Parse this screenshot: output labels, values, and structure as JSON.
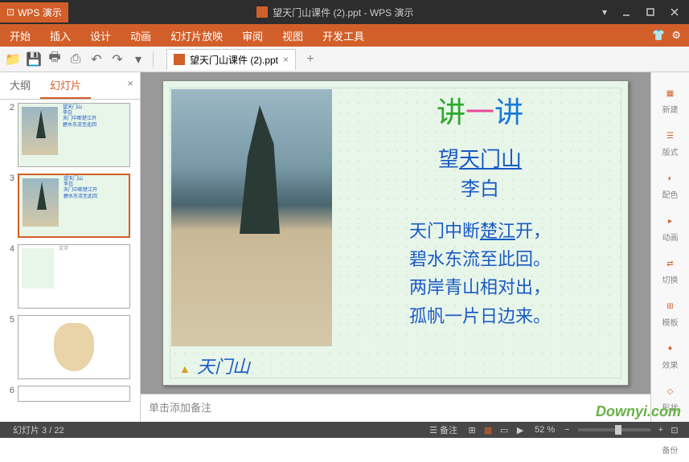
{
  "titlebar": {
    "app_name": "WPS 演示",
    "doc_title": "望天门山课件 (2).ppt - WPS 演示"
  },
  "menubar": {
    "items": [
      "开始",
      "插入",
      "设计",
      "动画",
      "幻灯片放映",
      "审阅",
      "视图",
      "开发工具"
    ]
  },
  "doc_tab": {
    "label": "望天门山课件 (2).ppt"
  },
  "left_panel": {
    "tabs": {
      "outline": "大纲",
      "slides": "幻灯片"
    },
    "thumbs": [
      {
        "num": "2"
      },
      {
        "num": "3"
      },
      {
        "num": "4"
      },
      {
        "num": "5"
      },
      {
        "num": "6"
      }
    ],
    "active_index": 1
  },
  "slide": {
    "title_chars": {
      "c1": "讲",
      "c2": "一",
      "c3": "讲"
    },
    "poem_title_prefix": "望",
    "poem_title_link": "天门山",
    "author": "李白",
    "lines": [
      {
        "text_before": "天门中断",
        "link": "楚江",
        "text_after": "开，"
      },
      {
        "text_before": "碧水东流至此回。",
        "link": "",
        "text_after": ""
      },
      {
        "text_before": "两岸青山相对出，",
        "link": "",
        "text_after": ""
      },
      {
        "text_before": "孤帆一片日边来。",
        "link": "",
        "text_after": ""
      }
    ],
    "caption": "天门山"
  },
  "notes": {
    "placeholder": "单击添加备注"
  },
  "right_panel": {
    "items": [
      {
        "icon": "new",
        "label": "新建"
      },
      {
        "icon": "layout",
        "label": "版式"
      },
      {
        "icon": "color",
        "label": "配色"
      },
      {
        "icon": "anim",
        "label": "动画"
      },
      {
        "icon": "trans",
        "label": "切换"
      },
      {
        "icon": "template",
        "label": "模板"
      },
      {
        "icon": "effect",
        "label": "效果"
      },
      {
        "icon": "shape",
        "label": "形状"
      },
      {
        "icon": "backup",
        "label": "备份"
      }
    ]
  },
  "statusbar": {
    "slide_info": "幻灯片 3 / 22",
    "notes_btn": "备注",
    "zoom": "52 %"
  },
  "watermark": "Downyi.com"
}
